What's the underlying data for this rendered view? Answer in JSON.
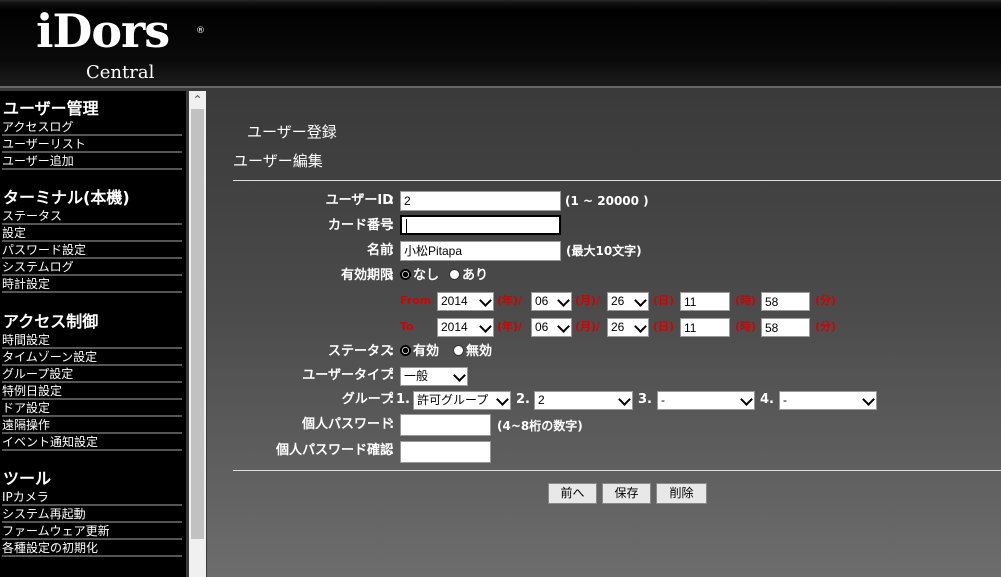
{
  "header": {
    "logo_main": "iDors",
    "logo_reg": "®",
    "logo_sub": "Central"
  },
  "sidebar": {
    "sections": [
      {
        "title": "ユーザー管理",
        "items": [
          "アクセスログ",
          "ユーザーリスト",
          "ユーザー追加"
        ]
      },
      {
        "title": "ターミナル(本機)",
        "items": [
          "ステータス",
          "設定",
          "パスワード設定",
          "システムログ",
          "時計設定"
        ]
      },
      {
        "title": "アクセス制御",
        "items": [
          "時間設定",
          "タイムゾーン設定",
          "グループ設定",
          "特例日設定",
          "ドア設定",
          "遠隔操作",
          "イベント通知設定"
        ]
      },
      {
        "title": "ツール",
        "items": [
          "IPカメラ",
          "システム再起動",
          "ファームウェア更新",
          "各種設定の初期化"
        ]
      }
    ]
  },
  "main": {
    "heading1": "ユーザー登録",
    "heading2": "ユーザー編集",
    "colon": ":",
    "user_id": {
      "label": "ユーザーID",
      "value": "2",
      "hint": "(1 ~ 20000 )"
    },
    "card": {
      "label": "カード番号",
      "value": ""
    },
    "name": {
      "label": "名前",
      "value": "小松Pitapa",
      "hint": "(最大10文字)"
    },
    "validity": {
      "label": "有効期限",
      "options": [
        "なし",
        "あり"
      ],
      "selected": "なし"
    },
    "from": {
      "label": "From",
      "year": "2014",
      "month": "06",
      "day": "26",
      "hour": "11",
      "minute": "58"
    },
    "to": {
      "label": "To",
      "year": "2014",
      "month": "06",
      "day": "26",
      "hour": "11",
      "minute": "58"
    },
    "units": {
      "year": "(年)/",
      "month": "(月)/",
      "day": "(日)",
      "hour": "(時)",
      "minute": "(分)"
    },
    "status": {
      "label": "ステータス",
      "options": [
        "有効",
        "無効"
      ],
      "selected": "有効"
    },
    "user_type": {
      "label": "ユーザータイプ",
      "value": "一般"
    },
    "group": {
      "label": "グループ",
      "nums": [
        "1.",
        "2.",
        "3.",
        "4."
      ],
      "values": [
        "許可グループ",
        "2",
        "-",
        "-"
      ]
    },
    "pw": {
      "label": "個人パスワード",
      "value": "",
      "hint": "(4~8桁の数字)"
    },
    "pw_confirm": {
      "label": "個人パスワード確認",
      "value": ""
    },
    "buttons": {
      "prev": "前へ",
      "save": "保存",
      "delete": "削除"
    }
  }
}
